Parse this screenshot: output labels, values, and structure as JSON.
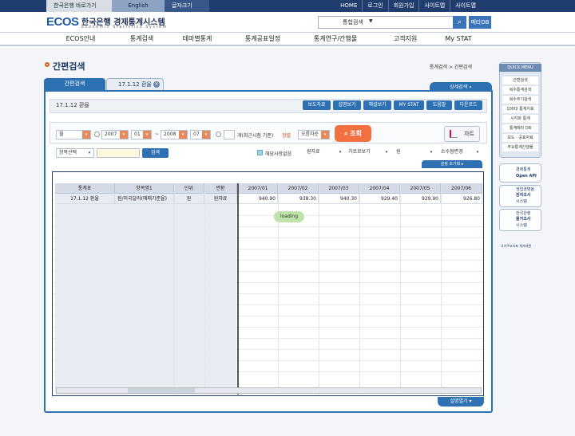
{
  "topbar": {
    "bok": "한국은행 바로가기",
    "english": "English",
    "font": "글자크기",
    "links": [
      "HOME",
      "로그인",
      "회원가입",
      "사이트맵",
      "사이트맵"
    ]
  },
  "header": {
    "logo": "ECOS",
    "logo_kr": "한국은행 경제통계시스템",
    "logo_en": "Economic Statistics System",
    "search_value": "통합검색",
    "metadb": "메타DB"
  },
  "nav": [
    "ECOS안내",
    "통계검색",
    "테마별통계",
    "통계공표일정",
    "통계연구/간행물",
    "고객지원",
    "My STAT"
  ],
  "page": {
    "title": "간편검색",
    "breadcrumb": "통계검색 > 간편검색",
    "tab1": "간편검색",
    "tab2": "17.1.12 환율",
    "detail": "상세검색 »"
  },
  "row": {
    "title": "17.1.12 환율",
    "actions": [
      "보도자료",
      "설명보기",
      "해설보기",
      "MY STAT",
      "도움말",
      "다운로드"
    ]
  },
  "filter": {
    "period": "월",
    "from_year": "2007",
    "from_month": "01",
    "dash": "~",
    "to_year": "2008",
    "to_month": "07",
    "count_label": "개(최근시점 기준)",
    "sort_label": "정렬",
    "sort_value": "오름차순",
    "search": "조회",
    "chart": "차트"
  },
  "filter2": {
    "item_select": "항목선택",
    "search_btn": "검색",
    "only_label": "해당사항없음",
    "opt1": "원자료",
    "opt2": "가로로보기",
    "opt3": "원",
    "opt4": "소수점변경"
  },
  "pager": "설정 초기화 ▸",
  "table": {
    "headers": [
      "통계표",
      "항목명1",
      "단위",
      "변환",
      "2007/01",
      "2007/02",
      "2007/03",
      "2007/04",
      "2007/05",
      "2007/06"
    ],
    "row": [
      "17.1.12 환율",
      "원/미국달러(매매기준율)",
      "원",
      "원자료",
      "940.90",
      "938.30",
      "940.30",
      "929.40",
      "929.90",
      "926.80"
    ]
  },
  "loading": "loading",
  "footer_btn": "설명열기 ▾",
  "quick": {
    "title": "QUICK MENU",
    "items": [
      "간편검색",
      "복수통계검색",
      "복수주기검색",
      "100대 통계지표",
      "시각화 통계",
      "통계메타 DB",
      "보도 · 공표자료",
      "주요통계간행물"
    ]
  },
  "side": {
    "openapi": [
      "경제통계",
      "Open API"
    ],
    "survey1": [
      "생업경영을",
      "전자조사",
      "시스템"
    ],
    "survey2": [
      "한국은행",
      "물가조사",
      "시스템"
    ],
    "gov": "국가주요지표 체계개편"
  }
}
